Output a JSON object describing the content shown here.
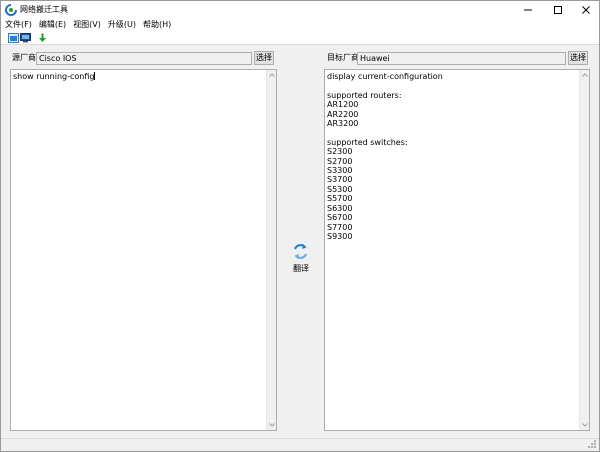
{
  "window": {
    "title": "网络搬迁工具"
  },
  "menu": {
    "items": [
      "文件(F)",
      "编辑(E)",
      "视图(V)",
      "升级(U)",
      "帮助(H)"
    ]
  },
  "toolbar": {
    "icons": [
      "window-tile-icon",
      "monitor-icon",
      "download-arrow-icon"
    ]
  },
  "source": {
    "label": "源厂商",
    "vendor": "Cisco IOS",
    "select_label": "选择",
    "text": "show running-config"
  },
  "target": {
    "label": "目标厂商",
    "vendor": "Huawei",
    "select_label": "选择",
    "text": "display current-configuration\n\nsupported routers:\nAR1200\nAR2200\nAR3200\n\nsupported switches:\nS2300\nS2700\nS3300\nS3700\nS5300\nS5700\nS6300\nS6700\nS7700\nS9300"
  },
  "translate": {
    "label": "翻译"
  },
  "colors": {
    "accent_blue": "#2a7fd6",
    "download_green": "#1aa31a"
  }
}
